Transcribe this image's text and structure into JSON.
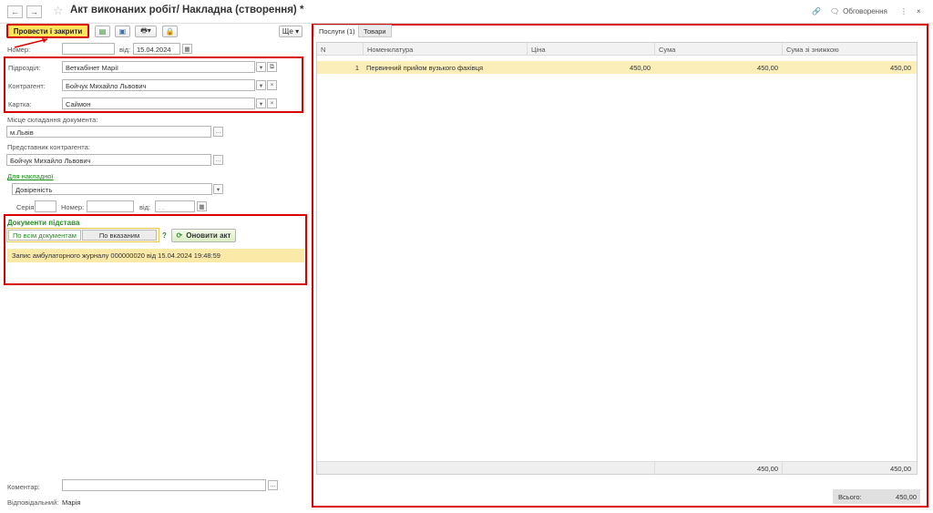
{
  "window": {
    "title": "Акт виконаних робіт/ Накладна (створення) *",
    "discussions_label": "Обговорення"
  },
  "toolbar": {
    "post_close_label": "Провести і закрити",
    "more_label": "Ще"
  },
  "header": {
    "number_label": "Номер:",
    "number_value": "",
    "date_label": "від:",
    "date_value": "15.04.2024"
  },
  "party": {
    "division_label": "Підрозділ:",
    "division_value": "Веткабінет Марії",
    "counterparty_label": "Контрагент:",
    "counterparty_value": "Бойчук Михайло Львович",
    "card_label": "Картка:",
    "card_value": "Саймон"
  },
  "place": {
    "label": "Місце складання документа:",
    "value": "м.Львів"
  },
  "representative": {
    "label": "Представник контрагента:",
    "value": "Бойчук Михайло Львович"
  },
  "invoice": {
    "link_label": "Для накладної",
    "type_value": "Довіреність",
    "series_label": "Серія:",
    "series_value": "",
    "number_label": "Номер:",
    "number_value": "",
    "date_label": "від:",
    "date_value": ". ."
  },
  "basis": {
    "title": "Документи підстава",
    "mode_all": "По всім документам",
    "mode_selected": "По вказаним",
    "help": "?",
    "refresh_label": "Оновити акт",
    "items": [
      "Запис амбулаторного журналу 000000020 від 15.04.2024 19:48:59"
    ]
  },
  "footer": {
    "comment_label": "Коментар:",
    "comment_value": "",
    "responsible_label": "Відповідальний:",
    "responsible_value": "Марія"
  },
  "tabs": [
    "Послуги (1)",
    "Товари"
  ],
  "grid": {
    "columns": [
      "N",
      "Номенклатура",
      "Ціна",
      "Сума",
      "Сума зі знижкою"
    ],
    "rows": [
      {
        "n": "1",
        "name": "Первинний прийом вузького фахівця",
        "price": "450,00",
        "sum": "450,00",
        "sum_discount": "450,00"
      }
    ],
    "footer_sum": "450,00",
    "footer_sum_discount": "450,00"
  },
  "total": {
    "label": "Всього:",
    "value": "450,00"
  },
  "colors": {
    "accent_red": "#d90000",
    "primary_button": "#ffe55c",
    "selected_row": "#fbeeb8",
    "green_text": "#2f8a2f"
  }
}
